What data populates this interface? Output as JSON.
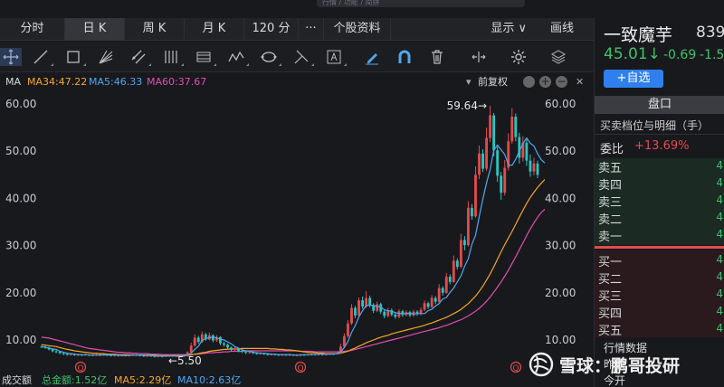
{
  "search": {
    "placeholder": "行情 / 功能 / 简拼"
  },
  "tabs": [
    {
      "label": "分时"
    },
    {
      "label": "日 K"
    },
    {
      "label": "周 K"
    },
    {
      "label": "月 K"
    },
    {
      "label": "120 分"
    },
    {
      "label": "···"
    },
    {
      "label": "个股资料"
    },
    {
      "label": "显示 ∨"
    },
    {
      "label": "画线"
    }
  ],
  "ma_bar": {
    "label": "MA",
    "ma34": "MA34:47.22",
    "ma5": "MA5:46.33",
    "ma60": "MA60:37.67",
    "fuquan": "前复权"
  },
  "volume_bar": {
    "label": "成交额",
    "total": "总金额:1.52亿",
    "ma5": "MA5:2.29亿",
    "ma10": "MA10:2.63亿"
  },
  "colors": {
    "up": "#e54b4b",
    "down": "#27c7c0",
    "ma34": "#f5a623",
    "ma5": "#4ea8f0",
    "ma60": "#e04fb3",
    "accent": "#2f80ed",
    "price_green": "#3ec26b"
  },
  "stock": {
    "name": "一致魔芋",
    "code": "839",
    "price": "45.01↓",
    "change": "-0.69",
    "pct": "-1.5",
    "add_button": "+自选",
    "panel_tab": "盘口",
    "detail_header": "买卖档位与明细（手）",
    "weibi_label": "委比",
    "weibi_value": "+13.69%",
    "sells": [
      {
        "label": "卖五",
        "v": "4"
      },
      {
        "label": "卖四",
        "v": "4"
      },
      {
        "label": "卖三",
        "v": "4"
      },
      {
        "label": "卖二",
        "v": "4"
      },
      {
        "label": "卖一",
        "v": "4"
      }
    ],
    "buys": [
      {
        "label": "买一",
        "v": "4"
      },
      {
        "label": "买二",
        "v": "4"
      },
      {
        "label": "买三",
        "v": "4"
      },
      {
        "label": "买四",
        "v": "4"
      },
      {
        "label": "买五",
        "v": "4"
      }
    ],
    "market_data": "行情数据",
    "prev_close": "昨收",
    "today_open": "今开"
  },
  "watermark": {
    "text": "雪球：鹏哥投研"
  },
  "chart_data": {
    "type": "candlestick",
    "y_ticks": [
      "60.00",
      "50.00",
      "40.00",
      "30.00",
      "20.00",
      "10.00"
    ],
    "ylim": [
      6,
      62
    ],
    "annotations": [
      {
        "text": "59.64→",
        "value": 59.64
      },
      {
        "text": "←5.50",
        "value": 5.5
      }
    ],
    "events": [
      "Q",
      "Q",
      "Q"
    ],
    "candles": [
      [
        8.6,
        8.5,
        9.0,
        8.3
      ],
      [
        8.5,
        8.4,
        8.8,
        8.1
      ],
      [
        8.4,
        8.0,
        8.6,
        7.8
      ],
      [
        8.0,
        7.6,
        8.2,
        7.4
      ],
      [
        7.6,
        7.5,
        7.9,
        7.2
      ],
      [
        7.5,
        7.2,
        7.7,
        7.0
      ],
      [
        7.2,
        7.0,
        7.5,
        6.8
      ],
      [
        7.0,
        6.9,
        7.3,
        6.7
      ],
      [
        6.9,
        7.0,
        7.2,
        6.7
      ],
      [
        7.0,
        6.8,
        7.2,
        6.6
      ],
      [
        6.8,
        6.9,
        7.1,
        6.6
      ],
      [
        6.9,
        6.8,
        7.0,
        6.6
      ],
      [
        6.8,
        6.9,
        7.1,
        6.7
      ],
      [
        6.9,
        6.8,
        7.0,
        6.6
      ],
      [
        6.8,
        6.8,
        7.0,
        6.6
      ],
      [
        6.8,
        6.9,
        7.1,
        6.6
      ],
      [
        6.9,
        6.8,
        7.0,
        6.6
      ],
      [
        6.8,
        6.9,
        7.0,
        6.7
      ],
      [
        6.9,
        6.8,
        7.0,
        6.6
      ],
      [
        6.8,
        6.7,
        6.9,
        6.5
      ],
      [
        6.7,
        6.8,
        7.0,
        6.5
      ],
      [
        6.8,
        6.7,
        6.9,
        6.5
      ],
      [
        6.7,
        6.8,
        6.9,
        6.5
      ],
      [
        6.8,
        6.7,
        6.9,
        6.5
      ],
      [
        6.7,
        6.8,
        7.0,
        6.5
      ],
      [
        6.8,
        6.9,
        7.1,
        6.6
      ],
      [
        6.9,
        6.8,
        7.0,
        6.6
      ],
      [
        6.8,
        6.7,
        6.9,
        6.5
      ],
      [
        6.7,
        6.6,
        6.8,
        6.4
      ],
      [
        6.6,
        6.7,
        6.9,
        6.4
      ],
      [
        6.7,
        6.6,
        6.8,
        6.4
      ],
      [
        6.6,
        6.5,
        6.7,
        6.3
      ],
      [
        6.5,
        6.6,
        6.8,
        6.3
      ],
      [
        6.6,
        6.5,
        6.7,
        6.3
      ],
      [
        6.5,
        6.6,
        6.8,
        6.4
      ],
      [
        6.6,
        6.7,
        6.9,
        6.4
      ],
      [
        6.7,
        6.6,
        6.8,
        6.4
      ],
      [
        6.6,
        6.6,
        6.8,
        6.4
      ],
      [
        6.6,
        6.7,
        6.9,
        6.4
      ],
      [
        6.7,
        6.6,
        6.8,
        6.4
      ],
      [
        6.6,
        7.4,
        7.6,
        6.5
      ],
      [
        7.4,
        8.8,
        9.4,
        7.2
      ],
      [
        8.8,
        10.5,
        11.2,
        8.6
      ],
      [
        10.5,
        9.6,
        10.9,
        9.2
      ],
      [
        9.6,
        11.2,
        11.8,
        9.4
      ],
      [
        11.2,
        10.1,
        11.5,
        9.8
      ],
      [
        10.1,
        11.0,
        11.6,
        9.9
      ],
      [
        11.0,
        9.9,
        11.2,
        9.5
      ],
      [
        9.9,
        10.6,
        11.0,
        9.6
      ],
      [
        10.6,
        9.3,
        10.8,
        8.9
      ],
      [
        9.3,
        9.0,
        9.6,
        8.6
      ],
      [
        9.0,
        8.4,
        9.2,
        8.0
      ],
      [
        8.4,
        7.9,
        8.6,
        7.6
      ],
      [
        7.9,
        8.2,
        8.5,
        7.6
      ],
      [
        8.2,
        7.7,
        8.3,
        7.4
      ],
      [
        7.7,
        7.5,
        7.9,
        7.2
      ],
      [
        7.5,
        7.3,
        7.7,
        7.0
      ],
      [
        7.3,
        7.4,
        7.6,
        7.1
      ],
      [
        7.4,
        7.2,
        7.6,
        7.0
      ],
      [
        7.2,
        7.1,
        7.4,
        6.9
      ],
      [
        7.1,
        7.2,
        7.4,
        6.9
      ],
      [
        7.2,
        7.0,
        7.3,
        6.8
      ],
      [
        7.0,
        6.9,
        7.2,
        6.7
      ],
      [
        6.9,
        7.0,
        7.2,
        6.7
      ],
      [
        7.0,
        6.9,
        7.1,
        6.7
      ],
      [
        6.9,
        6.8,
        7.0,
        6.6
      ],
      [
        6.8,
        6.9,
        7.1,
        6.6
      ],
      [
        6.9,
        6.8,
        7.0,
        6.6
      ],
      [
        6.8,
        6.9,
        7.1,
        6.6
      ],
      [
        6.9,
        6.8,
        7.0,
        6.6
      ],
      [
        6.8,
        6.8,
        7.0,
        6.6
      ],
      [
        6.8,
        6.9,
        7.1,
        6.6
      ],
      [
        6.9,
        6.8,
        7.0,
        6.6
      ],
      [
        6.8,
        6.9,
        7.1,
        6.7
      ],
      [
        6.9,
        7.0,
        7.2,
        6.7
      ],
      [
        7.0,
        6.9,
        7.1,
        6.7
      ],
      [
        6.9,
        7.0,
        7.2,
        6.7
      ],
      [
        7.0,
        6.9,
        7.1,
        6.7
      ],
      [
        6.9,
        7.0,
        7.2,
        6.7
      ],
      [
        7.0,
        7.1,
        7.3,
        6.8
      ],
      [
        7.1,
        7.0,
        7.2,
        6.8
      ],
      [
        7.0,
        7.2,
        7.4,
        6.9
      ],
      [
        7.2,
        8.6,
        9.2,
        7.1
      ],
      [
        8.6,
        10.8,
        11.4,
        8.4
      ],
      [
        10.8,
        13.5,
        14.2,
        10.5
      ],
      [
        13.5,
        16.8,
        17.6,
        13.2
      ],
      [
        16.8,
        15.2,
        17.2,
        14.6
      ],
      [
        15.2,
        18.4,
        19.0,
        14.9
      ],
      [
        18.4,
        17.1,
        19.2,
        16.6
      ],
      [
        17.1,
        18.9,
        20.3,
        16.8
      ],
      [
        18.9,
        17.4,
        19.4,
        16.9
      ],
      [
        17.4,
        16.2,
        17.8,
        15.7
      ],
      [
        16.2,
        17.6,
        18.1,
        15.9
      ],
      [
        17.6,
        16.0,
        17.9,
        15.5
      ],
      [
        16.0,
        15.1,
        16.4,
        14.6
      ],
      [
        15.1,
        16.3,
        16.8,
        14.8
      ],
      [
        16.3,
        15.4,
        16.7,
        15.0
      ],
      [
        15.4,
        14.9,
        15.8,
        14.5
      ],
      [
        14.9,
        16.1,
        16.5,
        14.6
      ],
      [
        16.1,
        15.3,
        16.4,
        14.9
      ],
      [
        15.3,
        15.9,
        16.3,
        15.0
      ],
      [
        15.9,
        15.2,
        16.2,
        14.8
      ],
      [
        15.2,
        16.0,
        16.4,
        14.9
      ],
      [
        16.0,
        15.5,
        16.3,
        15.1
      ],
      [
        15.5,
        16.4,
        16.9,
        15.2
      ],
      [
        16.4,
        17.8,
        18.4,
        16.1
      ],
      [
        17.8,
        17.0,
        18.1,
        16.6
      ],
      [
        17.0,
        18.9,
        19.5,
        16.8
      ],
      [
        18.9,
        18.1,
        19.3,
        17.6
      ],
      [
        18.1,
        21.0,
        21.8,
        17.9
      ],
      [
        21.0,
        20.0,
        21.4,
        19.4
      ],
      [
        20.0,
        23.4,
        24.2,
        19.8
      ],
      [
        23.4,
        22.3,
        23.9,
        21.8
      ],
      [
        22.3,
        26.8,
        27.9,
        22.1
      ],
      [
        26.8,
        25.5,
        27.3,
        24.9
      ],
      [
        25.5,
        31.2,
        32.5,
        25.2
      ],
      [
        31.2,
        30.1,
        32.0,
        29.0
      ],
      [
        30.1,
        38.0,
        39.4,
        29.8
      ],
      [
        38.0,
        36.2,
        38.8,
        35.5
      ],
      [
        36.2,
        45.0,
        46.8,
        35.9
      ],
      [
        45.0,
        49.5,
        51.2,
        44.1
      ],
      [
        49.5,
        46.3,
        50.4,
        45.6
      ],
      [
        46.3,
        52.8,
        55.0,
        45.8
      ],
      [
        52.8,
        57.6,
        59.6,
        51.9
      ],
      [
        57.6,
        50.2,
        58.1,
        48.9
      ],
      [
        50.2,
        44.8,
        51.0,
        43.5
      ],
      [
        44.8,
        41.2,
        45.6,
        39.7
      ],
      [
        41.2,
        46.5,
        48.1,
        40.6
      ],
      [
        46.5,
        52.1,
        53.8,
        45.9
      ],
      [
        52.1,
        57.3,
        59.1,
        51.6
      ],
      [
        57.3,
        53.0,
        58.0,
        52.1
      ],
      [
        53.0,
        48.6,
        53.9,
        47.4
      ],
      [
        48.6,
        51.8,
        53.2,
        47.8
      ],
      [
        51.8,
        48.0,
        52.6,
        46.9
      ],
      [
        48.0,
        45.7,
        49.3,
        44.6
      ],
      [
        45.7,
        47.4,
        48.6,
        44.9
      ],
      [
        47.4,
        45.0,
        48.0,
        44.3
      ]
    ],
    "ma5": [
      8.6,
      8.5,
      8.3,
      8.1,
      8.0,
      7.6,
      7.4,
      7.2,
      7.1,
      7.0,
      6.9,
      6.9,
      6.9,
      6.8,
      6.8,
      6.8,
      6.8,
      6.8,
      6.8,
      6.8,
      6.8,
      6.8,
      6.7,
      6.7,
      6.7,
      6.8,
      6.8,
      6.8,
      6.7,
      6.7,
      6.7,
      6.6,
      6.6,
      6.6,
      6.6,
      6.6,
      6.6,
      6.6,
      6.6,
      6.6,
      6.8,
      7.2,
      8.0,
      8.7,
      9.9,
      10.3,
      10.5,
      10.6,
      10.5,
      10.2,
      10.0,
      9.6,
      9.2,
      8.6,
      8.3,
      7.9,
      7.7,
      7.6,
      7.4,
      7.3,
      7.2,
      7.2,
      7.1,
      7.0,
      7.0,
      6.9,
      6.9,
      6.9,
      6.9,
      6.8,
      6.8,
      6.8,
      6.9,
      6.9,
      6.9,
      6.9,
      7.0,
      7.0,
      7.0,
      7.0,
      7.0,
      7.1,
      7.5,
      8.4,
      9.7,
      11.6,
      13.0,
      14.9,
      16.2,
      17.3,
      17.4,
      17.3,
      17.1,
      17.0,
      16.4,
      16.2,
      16.1,
      15.8,
      15.6,
      15.6,
      15.6,
      15.7,
      15.5,
      15.6,
      15.6,
      15.6,
      16.2,
      16.5,
      17.2,
      17.7,
      18.7,
      19.0,
      20.1,
      21.0,
      22.3,
      23.6,
      25.6,
      27.2,
      30.3,
      32.2,
      36.1,
      39.8,
      43.3,
      46.1,
      50.2,
      51.3,
      50.3,
      49.3,
      47.1,
      47.0,
      48.3,
      50.0,
      51.6,
      52.8,
      51.7,
      51.1,
      49.5,
      48.2,
      47.5
    ],
    "ma34": [
      9.0,
      8.9,
      8.8,
      8.7,
      8.6,
      8.4,
      8.2,
      8.0,
      7.9,
      7.7,
      7.6,
      7.5,
      7.4,
      7.3,
      7.2,
      7.2,
      7.1,
      7.1,
      7.0,
      7.0,
      7.0,
      6.9,
      6.9,
      6.9,
      6.9,
      6.8,
      6.8,
      6.8,
      6.8,
      6.8,
      6.8,
      6.8,
      6.7,
      6.7,
      6.7,
      6.7,
      6.7,
      6.7,
      6.7,
      6.7,
      6.7,
      6.8,
      7.0,
      7.1,
      7.3,
      7.4,
      7.6,
      7.7,
      7.8,
      7.9,
      8.0,
      8.0,
      8.1,
      8.1,
      8.1,
      8.2,
      8.2,
      8.2,
      8.2,
      8.2,
      8.2,
      8.2,
      8.2,
      8.1,
      8.1,
      8.0,
      8.0,
      7.9,
      7.9,
      7.8,
      7.7,
      7.6,
      7.5,
      7.4,
      7.3,
      7.3,
      7.2,
      7.2,
      7.1,
      7.1,
      7.1,
      7.1,
      7.2,
      7.4,
      7.6,
      8.0,
      8.3,
      8.7,
      9.0,
      9.4,
      9.7,
      10.0,
      10.3,
      10.6,
      10.8,
      11.0,
      11.3,
      11.5,
      11.7,
      11.9,
      12.1,
      12.3,
      12.5,
      12.7,
      12.9,
      13.1,
      13.4,
      13.6,
      13.9,
      14.2,
      14.5,
      14.8,
      15.2,
      15.6,
      16.0,
      16.5,
      17.1,
      17.7,
      18.5,
      19.3,
      20.3,
      21.4,
      22.7,
      24.0,
      25.5,
      27.1,
      28.7,
      30.2,
      31.6,
      33.0,
      34.5,
      36.0,
      37.5,
      38.9,
      40.2,
      41.3,
      42.3,
      43.2,
      44.0
    ],
    "ma60": [
      10.6,
      10.5,
      10.4,
      10.2,
      10.0,
      9.8,
      9.6,
      9.4,
      9.2,
      9.0,
      8.8,
      8.6,
      8.4,
      8.2,
      8.1,
      8.0,
      7.9,
      7.8,
      7.7,
      7.6,
      7.5,
      7.4,
      7.4,
      7.3,
      7.3,
      7.2,
      7.2,
      7.1,
      7.1,
      7.1,
      7.0,
      7.0,
      7.0,
      6.9,
      6.9,
      6.9,
      6.9,
      6.9,
      6.9,
      6.9,
      6.9,
      6.9,
      7.0,
      7.0,
      7.1,
      7.2,
      7.3,
      7.3,
      7.4,
      7.4,
      7.5,
      7.5,
      7.6,
      7.6,
      7.6,
      7.6,
      7.7,
      7.7,
      7.7,
      7.7,
      7.7,
      7.7,
      7.7,
      7.7,
      7.7,
      7.7,
      7.7,
      7.7,
      7.7,
      7.7,
      7.7,
      7.6,
      7.6,
      7.6,
      7.6,
      7.5,
      7.5,
      7.5,
      7.5,
      7.5,
      7.5,
      7.5,
      7.5,
      7.6,
      7.7,
      7.8,
      8.0,
      8.2,
      8.4,
      8.6,
      8.8,
      9.0,
      9.2,
      9.4,
      9.6,
      9.8,
      10.0,
      10.2,
      10.4,
      10.6,
      10.8,
      11.0,
      11.2,
      11.4,
      11.6,
      11.8,
      12.0,
      12.2,
      12.4,
      12.6,
      12.9,
      13.1,
      13.4,
      13.7,
      14.0,
      14.3,
      14.7,
      15.1,
      15.6,
      16.1,
      16.7,
      17.4,
      18.2,
      19.1,
      20.1,
      21.2,
      22.3,
      23.5,
      24.8,
      26.2,
      27.6,
      29.1,
      30.6,
      32.1,
      33.5,
      34.8,
      36.0,
      37.0,
      37.7
    ]
  }
}
